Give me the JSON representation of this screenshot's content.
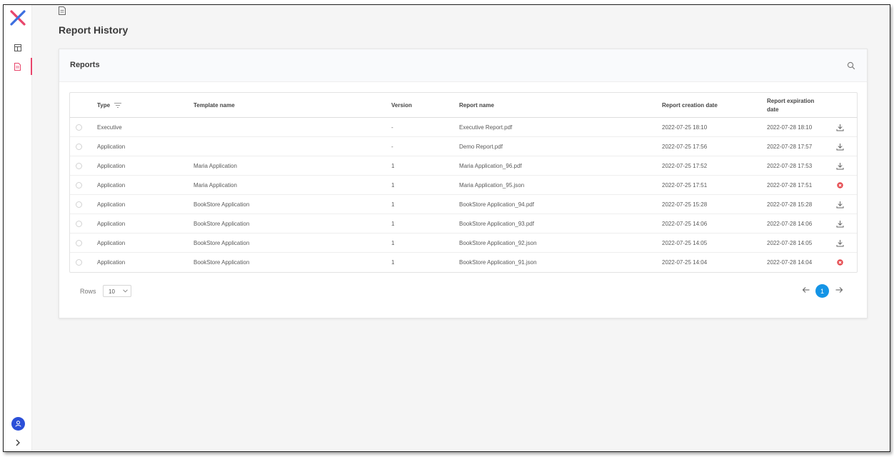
{
  "colors": {
    "accent": "#e8456b",
    "primary": "#1494e6",
    "avatar": "#2b4fd8",
    "error": "#e5484d"
  },
  "sidebar": {
    "items": [
      {
        "name": "dashboard",
        "icon": "dashboard-icon",
        "active": false
      },
      {
        "name": "reports",
        "icon": "report-icon",
        "active": true
      }
    ]
  },
  "page": {
    "title": "Report History"
  },
  "card": {
    "title": "Reports"
  },
  "table": {
    "headers": {
      "type": "Type",
      "template": "Template name",
      "version": "Version",
      "report": "Report name",
      "created": "Report creation date",
      "expires_1": "Report expiration",
      "expires_2": "date"
    },
    "rows": [
      {
        "type": "Executive",
        "template": "",
        "version": "-",
        "report": "Executive Report.pdf",
        "created": "2022-07-25 18:10",
        "expires": "2022-07-28 18:10",
        "action": "download-icon"
      },
      {
        "type": "Application",
        "template": "",
        "version": "-",
        "report": "Demo Report.pdf",
        "created": "2022-07-25 17:56",
        "expires": "2022-07-28 17:57",
        "action": "download-icon"
      },
      {
        "type": "Application",
        "template": "Maria Application",
        "version": "1",
        "report": "Maria Application_96.pdf",
        "created": "2022-07-25 17:52",
        "expires": "2022-07-28 17:53",
        "action": "download-icon"
      },
      {
        "type": "Application",
        "template": "Maria Application",
        "version": "1",
        "report": "Maria Application_95.json",
        "created": "2022-07-25 17:51",
        "expires": "2022-07-28 17:51",
        "action": "error-icon"
      },
      {
        "type": "Application",
        "template": "BookStore Application",
        "version": "1",
        "report": "BookStore Application_94.pdf",
        "created": "2022-07-25 15:28",
        "expires": "2022-07-28 15:28",
        "action": "download-icon"
      },
      {
        "type": "Application",
        "template": "BookStore Application",
        "version": "1",
        "report": "BookStore Application_93.pdf",
        "created": "2022-07-25 14:06",
        "expires": "2022-07-28 14:06",
        "action": "download-icon"
      },
      {
        "type": "Application",
        "template": "BookStore Application",
        "version": "1",
        "report": "BookStore Application_92.json",
        "created": "2022-07-25 14:05",
        "expires": "2022-07-28 14:05",
        "action": "download-icon"
      },
      {
        "type": "Application",
        "template": "BookStore Application",
        "version": "1",
        "report": "BookStore Application_91.json",
        "created": "2022-07-25 14:04",
        "expires": "2022-07-28 14:04",
        "action": "error-icon"
      }
    ]
  },
  "pagination": {
    "rows_label": "Rows",
    "rows_value": "10",
    "current_page": "1"
  }
}
